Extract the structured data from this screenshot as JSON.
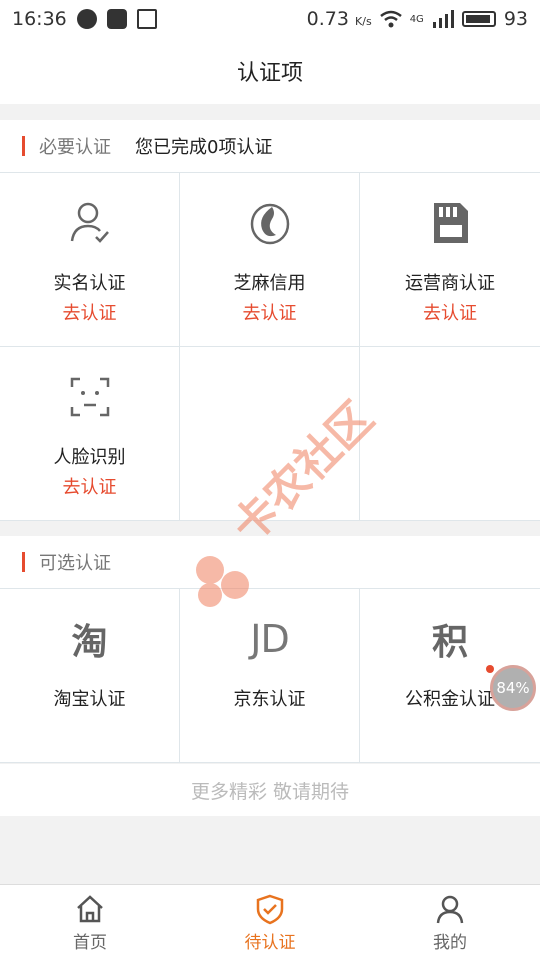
{
  "status_bar": {
    "time": "16:36",
    "speed": "0.73",
    "speed_unit": "K/s",
    "network": "4G",
    "battery": "93"
  },
  "header": {
    "title": "认证项"
  },
  "required": {
    "label": "必要认证",
    "status": "您已完成0项认证",
    "items": [
      {
        "title": "实名认证",
        "action": "去认证",
        "icon": "person-check-icon"
      },
      {
        "title": "芝麻信用",
        "action": "去认证",
        "icon": "sesame-icon"
      },
      {
        "title": "运营商认证",
        "action": "去认证",
        "icon": "sim-card-icon"
      },
      {
        "title": "人脸识别",
        "action": "去认证",
        "icon": "face-scan-icon"
      }
    ]
  },
  "optional": {
    "label": "可选认证",
    "items": [
      {
        "title": "淘宝认证",
        "glyph": "淘",
        "icon": "taobao-icon"
      },
      {
        "title": "京东认证",
        "glyph": "JD",
        "icon": "jd-icon"
      },
      {
        "title": "公积金认证",
        "glyph": "积",
        "icon": "fund-icon"
      }
    ]
  },
  "more_text": "更多精彩 敬请期待",
  "float_bubble": {
    "percent": "84%"
  },
  "tabbar": {
    "items": [
      {
        "label": "首页",
        "icon": "home-icon"
      },
      {
        "label": "待认证",
        "icon": "shield-check-icon"
      },
      {
        "label": "我的",
        "icon": "user-icon"
      }
    ],
    "active_color": "#e8731f"
  },
  "colors": {
    "accent": "#e64b2f",
    "tab_active": "#e8731f"
  },
  "watermark": {
    "text": "卡农社区"
  }
}
